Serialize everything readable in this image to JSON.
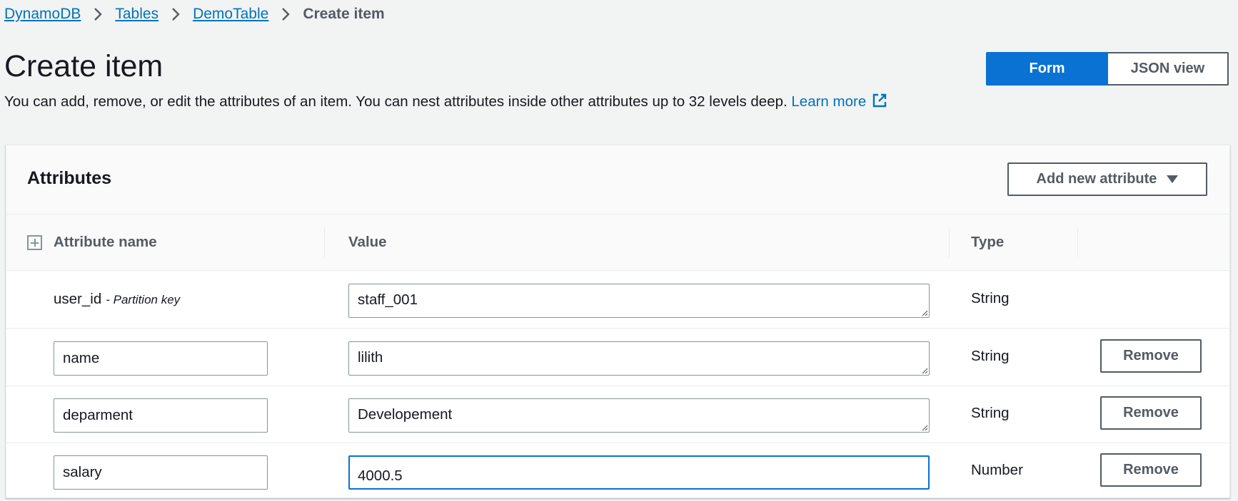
{
  "breadcrumb": {
    "items": [
      "DynamoDB",
      "Tables",
      "DemoTable"
    ],
    "current": "Create item"
  },
  "page": {
    "title": "Create item",
    "description": "You can add, remove, or edit the attributes of an item. You can nest attributes inside other attributes up to 32 levels deep.",
    "learn_more": "Learn more"
  },
  "view_toggle": {
    "form": "Form",
    "json": "JSON view",
    "selected": "Form"
  },
  "attributes": {
    "title": "Attributes",
    "add_button": "Add new attribute",
    "columns": {
      "name": "Attribute name",
      "value": "Value",
      "type": "Type"
    },
    "rows": [
      {
        "name": "user_id",
        "key_label": "- Partition key",
        "value": "staff_001",
        "type": "String"
      },
      {
        "name": "name",
        "value": "lilith",
        "type": "String",
        "remove": "Remove"
      },
      {
        "name": "deparment",
        "value": "Developement",
        "type": "String",
        "remove": "Remove"
      },
      {
        "name": "salary",
        "value": "4000.5",
        "type": "Number",
        "remove": "Remove"
      }
    ]
  },
  "colors": {
    "link": "#0073bb",
    "primary": "#0972d3",
    "background": "#f2f3f3",
    "border": "#879596",
    "secondary_text": "#545b64"
  }
}
